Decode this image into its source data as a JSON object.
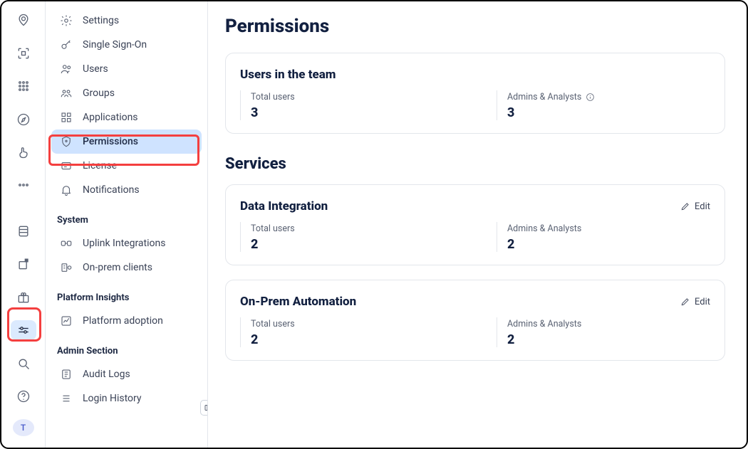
{
  "rail": {
    "avatar_initial": "T"
  },
  "nav": {
    "items_top": [
      {
        "label": "Settings"
      },
      {
        "label": "Single Sign-On"
      },
      {
        "label": "Users"
      },
      {
        "label": "Groups"
      },
      {
        "label": "Applications"
      },
      {
        "label": "Permissions"
      },
      {
        "label": "License"
      },
      {
        "label": "Notifications"
      }
    ],
    "section_system": "System",
    "items_system": [
      {
        "label": "Uplink Integrations"
      },
      {
        "label": "On-prem clients"
      }
    ],
    "section_insights": "Platform Insights",
    "items_insights": [
      {
        "label": "Platform adoption"
      }
    ],
    "section_admin": "Admin Section",
    "items_admin": [
      {
        "label": "Audit Logs"
      },
      {
        "label": "Login History"
      }
    ]
  },
  "page": {
    "title": "Permissions",
    "services_heading": "Services",
    "edit_label": "Edit",
    "team_card": {
      "title": "Users in the team",
      "total_label": "Total users",
      "total_value": "3",
      "aa_label": "Admins & Analysts",
      "aa_value": "3"
    },
    "service_cards": [
      {
        "title": "Data Integration",
        "total_label": "Total users",
        "total_value": "2",
        "aa_label": "Admins & Analysts",
        "aa_value": "2"
      },
      {
        "title": "On-Prem Automation",
        "total_label": "Total users",
        "total_value": "2",
        "aa_label": "Admins & Analysts",
        "aa_value": "2"
      }
    ]
  }
}
